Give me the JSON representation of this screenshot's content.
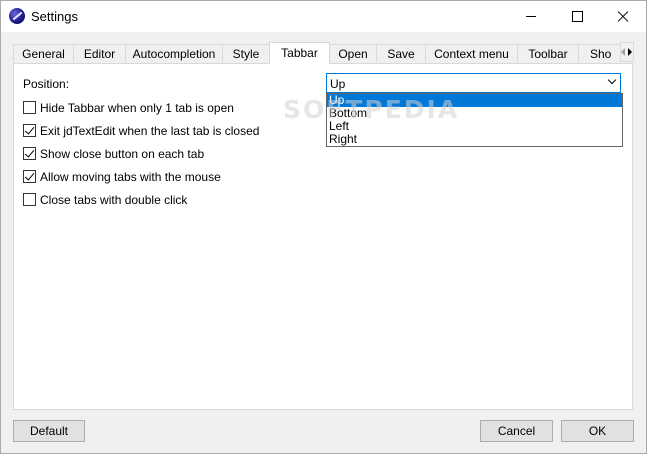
{
  "window": {
    "title": "Settings"
  },
  "tabs": [
    "General",
    "Editor",
    "Autocompletion",
    "Style",
    "Tabbar",
    "Open",
    "Save",
    "Context menu",
    "Toolbar",
    "Sho"
  ],
  "active_tab": "Tabbar",
  "position": {
    "label": "Position:",
    "selected": "Up",
    "options": [
      "Up",
      "Bottom",
      "Left",
      "Right"
    ]
  },
  "options": [
    {
      "label": "Hide Tabbar when only 1 tab is open",
      "checked": false
    },
    {
      "label": "Exit jdTextEdit when the last tab is closed",
      "checked": true
    },
    {
      "label": "Show close button on each tab",
      "checked": true
    },
    {
      "label": "Allow moving tabs with the mouse",
      "checked": true
    },
    {
      "label": "Close tabs with double click",
      "checked": false
    }
  ],
  "buttons": {
    "default": "Default",
    "cancel": "Cancel",
    "ok": "OK"
  },
  "watermark": "SOFTPEDIA"
}
